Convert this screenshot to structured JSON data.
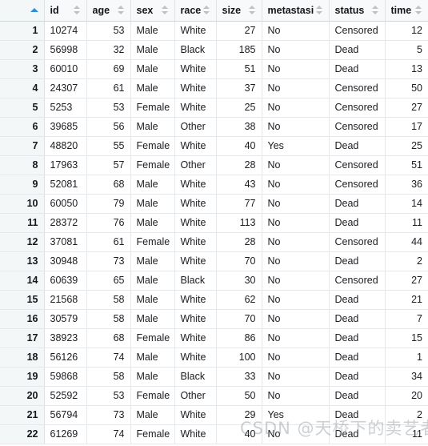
{
  "grid": {
    "sort": {
      "active_column": "rownum",
      "direction": "asc",
      "active_color": "#2e8fd6",
      "inactive_color": "#b4b8bb"
    },
    "rownum_header_label": "",
    "columns": [
      {
        "key": "id",
        "label": "id",
        "align": "left",
        "sortable": true
      },
      {
        "key": "age",
        "label": "age",
        "align": "right",
        "sortable": true
      },
      {
        "key": "sex",
        "label": "sex",
        "align": "left",
        "sortable": true
      },
      {
        "key": "race",
        "label": "race",
        "align": "left",
        "sortable": true
      },
      {
        "key": "size",
        "label": "size",
        "align": "right",
        "sortable": true
      },
      {
        "key": "metastasis",
        "label": "metastasis",
        "align": "left",
        "sortable": true
      },
      {
        "key": "status",
        "label": "status",
        "align": "left",
        "sortable": true
      },
      {
        "key": "time",
        "label": "time",
        "align": "right",
        "sortable": true
      }
    ],
    "rows": [
      {
        "n": "1",
        "id": "10274",
        "age": "53",
        "sex": "Male",
        "race": "White",
        "size": "27",
        "metastasis": "No",
        "status": "Censored",
        "time": "12"
      },
      {
        "n": "2",
        "id": "56998",
        "age": "32",
        "sex": "Male",
        "race": "Black",
        "size": "185",
        "metastasis": "No",
        "status": "Dead",
        "time": "5"
      },
      {
        "n": "3",
        "id": "60010",
        "age": "69",
        "sex": "Male",
        "race": "White",
        "size": "51",
        "metastasis": "No",
        "status": "Dead",
        "time": "13"
      },
      {
        "n": "4",
        "id": "24307",
        "age": "61",
        "sex": "Male",
        "race": "White",
        "size": "37",
        "metastasis": "No",
        "status": "Censored",
        "time": "50"
      },
      {
        "n": "5",
        "id": "5253",
        "age": "53",
        "sex": "Female",
        "race": "White",
        "size": "25",
        "metastasis": "No",
        "status": "Censored",
        "time": "27"
      },
      {
        "n": "6",
        "id": "39685",
        "age": "56",
        "sex": "Male",
        "race": "Other",
        "size": "38",
        "metastasis": "No",
        "status": "Censored",
        "time": "17"
      },
      {
        "n": "7",
        "id": "48820",
        "age": "55",
        "sex": "Female",
        "race": "White",
        "size": "40",
        "metastasis": "Yes",
        "status": "Dead",
        "time": "25"
      },
      {
        "n": "8",
        "id": "17963",
        "age": "57",
        "sex": "Female",
        "race": "Other",
        "size": "28",
        "metastasis": "No",
        "status": "Censored",
        "time": "51"
      },
      {
        "n": "9",
        "id": "52081",
        "age": "68",
        "sex": "Male",
        "race": "White",
        "size": "43",
        "metastasis": "No",
        "status": "Censored",
        "time": "36"
      },
      {
        "n": "10",
        "id": "60050",
        "age": "79",
        "sex": "Male",
        "race": "White",
        "size": "77",
        "metastasis": "No",
        "status": "Dead",
        "time": "14"
      },
      {
        "n": "11",
        "id": "28372",
        "age": "76",
        "sex": "Male",
        "race": "White",
        "size": "113",
        "metastasis": "No",
        "status": "Dead",
        "time": "11"
      },
      {
        "n": "12",
        "id": "37081",
        "age": "61",
        "sex": "Female",
        "race": "White",
        "size": "28",
        "metastasis": "No",
        "status": "Censored",
        "time": "44"
      },
      {
        "n": "13",
        "id": "30948",
        "age": "73",
        "sex": "Male",
        "race": "White",
        "size": "70",
        "metastasis": "No",
        "status": "Dead",
        "time": "2"
      },
      {
        "n": "14",
        "id": "60639",
        "age": "65",
        "sex": "Male",
        "race": "Black",
        "size": "30",
        "metastasis": "No",
        "status": "Censored",
        "time": "27"
      },
      {
        "n": "15",
        "id": "21568",
        "age": "58",
        "sex": "Male",
        "race": "White",
        "size": "62",
        "metastasis": "No",
        "status": "Dead",
        "time": "21"
      },
      {
        "n": "16",
        "id": "30579",
        "age": "58",
        "sex": "Male",
        "race": "White",
        "size": "70",
        "metastasis": "No",
        "status": "Dead",
        "time": "7"
      },
      {
        "n": "17",
        "id": "38923",
        "age": "68",
        "sex": "Female",
        "race": "White",
        "size": "86",
        "metastasis": "No",
        "status": "Dead",
        "time": "15"
      },
      {
        "n": "18",
        "id": "56126",
        "age": "74",
        "sex": "Male",
        "race": "White",
        "size": "100",
        "metastasis": "No",
        "status": "Dead",
        "time": "1"
      },
      {
        "n": "19",
        "id": "59868",
        "age": "58",
        "sex": "Male",
        "race": "Black",
        "size": "33",
        "metastasis": "No",
        "status": "Dead",
        "time": "34"
      },
      {
        "n": "20",
        "id": "52592",
        "age": "53",
        "sex": "Female",
        "race": "Other",
        "size": "50",
        "metastasis": "No",
        "status": "Dead",
        "time": "20"
      },
      {
        "n": "21",
        "id": "56794",
        "age": "73",
        "sex": "Male",
        "race": "White",
        "size": "29",
        "metastasis": "Yes",
        "status": "Dead",
        "time": "2"
      },
      {
        "n": "22",
        "id": "61269",
        "age": "74",
        "sex": "Female",
        "race": "White",
        "size": "40",
        "metastasis": "No",
        "status": "Dead",
        "time": "11"
      }
    ]
  },
  "watermark": {
    "text": "CSDN @天桥下的卖艺者"
  }
}
